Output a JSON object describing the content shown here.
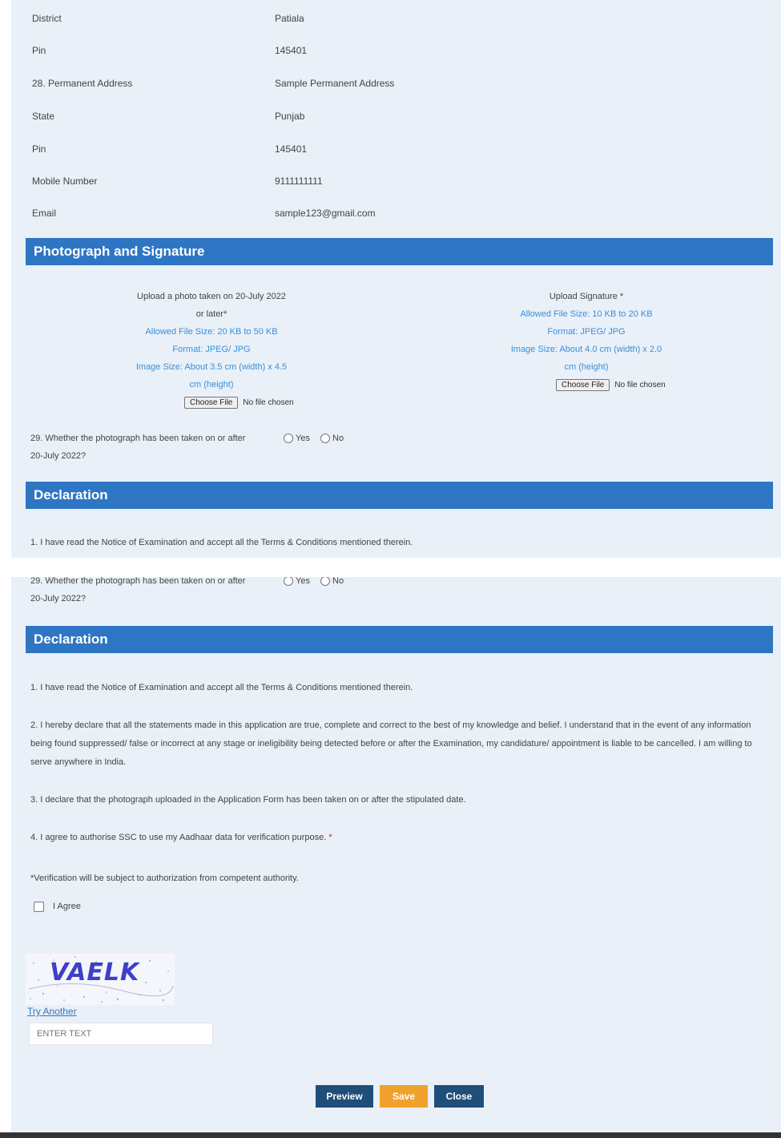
{
  "personal_rows": [
    {
      "label": "District",
      "value": "Patiala"
    },
    {
      "label": "Pin",
      "value": "145401"
    },
    {
      "label": "28. Permanent Address",
      "value": "Sample Permanent Address"
    },
    {
      "label": "State",
      "value": "Punjab"
    },
    {
      "label": "Pin",
      "value": "145401"
    },
    {
      "label": "Mobile Number",
      "value": "9111111111"
    },
    {
      "label": "Email",
      "value": "sample123@gmail.com"
    }
  ],
  "photo_section": {
    "title": "Photograph and Signature",
    "photo": {
      "heading_line1": "Upload a photo taken on 20-July 2022",
      "heading_line2": "or later*",
      "size_info": "Allowed File Size: 20 KB to 50 KB",
      "format_info": "Format: JPEG/ JPG",
      "dim_info_line1": "Image Size: About 3.5 cm (width) x 4.5",
      "dim_info_line2": "cm (height)",
      "file_button": "Choose File",
      "file_status": "No file chosen"
    },
    "signature": {
      "heading": "Upload Signature *",
      "size_info": "Allowed File Size: 10 KB to 20 KB",
      "format_info": "Format: JPEG/ JPG",
      "dim_info_line1": "Image Size: About 4.0 cm (width) x 2.0",
      "dim_info_line2": "cm (height)",
      "file_button": "Choose File",
      "file_status": "No file chosen"
    },
    "question": {
      "line1": "29. Whether the photograph has been taken on or after",
      "line2": "20-July 2022?",
      "yes_label": "Yes",
      "no_label": "No"
    }
  },
  "declaration": {
    "title": "Declaration",
    "item1": "1. I have read the Notice of Examination and accept all the Terms & Conditions mentioned therein.",
    "item2": "2. I hereby declare that all the statements made in this application are true, complete and correct to the best of my knowledge and belief. I understand that in the event of any information being found suppressed/ false or incorrect at any stage or ineligibility being detected before or after the Examination, my candidature/ appointment is liable to be cancelled. I am willing to serve anywhere in India.",
    "item3": "3. I declare that the photograph uploaded in the Application Form has been taken on or after the stipulated date.",
    "item4": "4. I agree to authorise SSC to use my Aadhaar data for verification purpose.",
    "item4_required": "*",
    "note": "*Verification will be subject to authorization from competent authority.",
    "agree_label": "I Agree"
  },
  "captcha": {
    "text": "VAELK",
    "label": "Try Another",
    "placeholder": "ENTER TEXT"
  },
  "buttons": {
    "preview": "Preview",
    "save": "Save",
    "close": "Close"
  },
  "colors": {
    "section_header": "#2e76c4",
    "panel_bg": "#e9f0f8",
    "link_blue": "#3b8fd9",
    "button_navy": "#1f4e79",
    "button_orange": "#f0a22c"
  }
}
